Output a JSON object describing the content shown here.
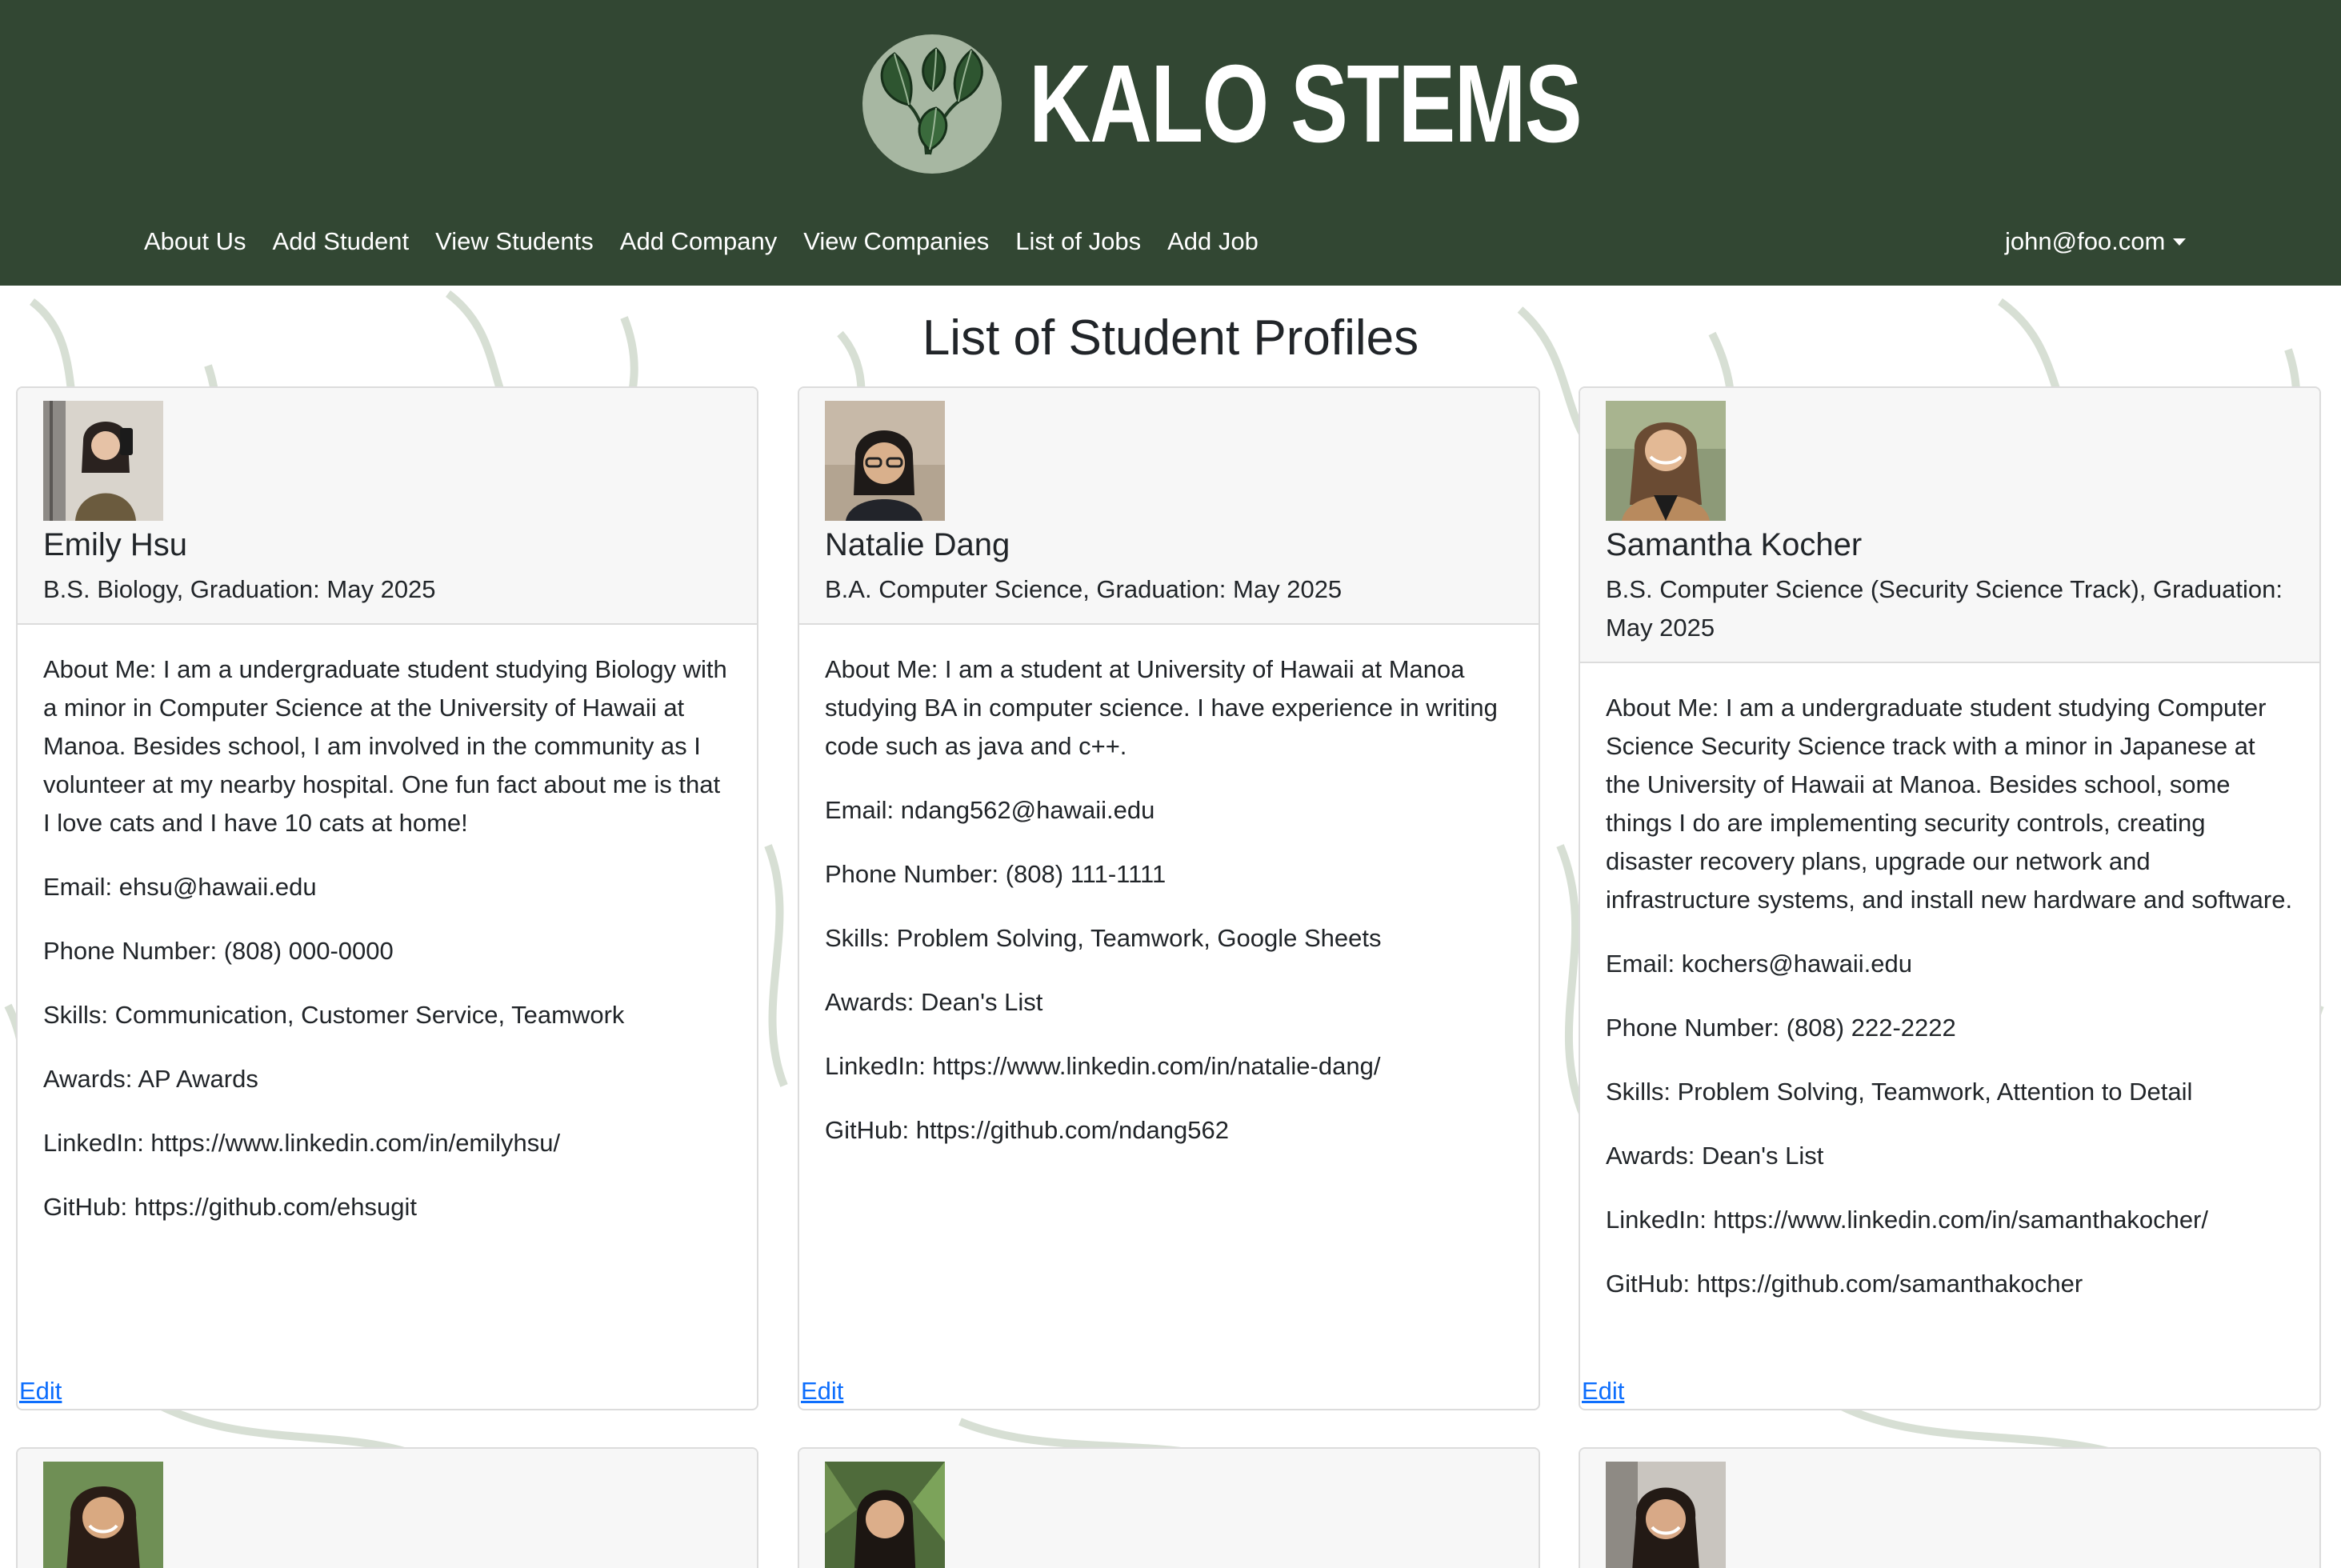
{
  "brand": {
    "title": "KALO STEMS",
    "logo_icon": "taro-leaf-icon",
    "color_navbar": "#324733"
  },
  "nav": {
    "items": [
      {
        "label": "About Us"
      },
      {
        "label": "Add Student"
      },
      {
        "label": "View Students"
      },
      {
        "label": "Add Company"
      },
      {
        "label": "View Companies"
      },
      {
        "label": "List of Jobs"
      },
      {
        "label": "Add Job"
      }
    ],
    "user": "john@foo.com"
  },
  "page": {
    "title": "List of Student Profiles"
  },
  "cards": [
    {
      "name": "Emily Hsu",
      "degree": "B.S. Biology, Graduation: May 2025",
      "about": "About Me: I am a undergraduate student studying Biology with a minor in Computer Science at the University of Hawaii at Manoa. Besides school, I am involved in the community as I volunteer at my nearby hospital. One fun fact about me is that I love cats and I have 10 cats at home!",
      "email": "Email: ehsu@hawaii.edu",
      "phone": "Phone Number: (808) 000-0000",
      "skills": "Skills: Communication, Customer Service, Teamwork",
      "awards": "Awards: AP Awards",
      "linkedin": "LinkedIn: https://www.linkedin.com/in/emilyhsu/",
      "github": "GitHub: https://github.com/ehsugit",
      "edit": "Edit"
    },
    {
      "name": "Natalie Dang",
      "degree": "B.A. Computer Science, Graduation: May 2025",
      "about": "About Me: I am a student at University of Hawaii at Manoa studying BA in computer science. I have experience in writing code such as java and c++.",
      "email": "Email: ndang562@hawaii.edu",
      "phone": "Phone Number: (808) 111-1111",
      "skills": "Skills: Problem Solving, Teamwork, Google Sheets",
      "awards": "Awards: Dean's List",
      "linkedin": "LinkedIn: https://www.linkedin.com/in/natalie-dang/",
      "github": "GitHub: https://github.com/ndang562",
      "edit": "Edit"
    },
    {
      "name": "Samantha Kocher",
      "degree": "B.S. Computer Science (Security Science Track), Graduation: May 2025",
      "about": "About Me: I am a undergraduate student studying Computer Science Security Science track with a minor in Japanese at the University of Hawaii at Manoa. Besides school, some things I do are implementing security controls, creating disaster recovery plans, upgrade our network and infrastructure systems, and install new hardware and software.",
      "email": "Email: kochers@hawaii.edu",
      "phone": "Phone Number: (808) 222-2222",
      "skills": "Skills: Problem Solving, Teamwork, Attention to Detail",
      "awards": "Awards: Dean's List",
      "linkedin": "LinkedIn: https://www.linkedin.com/in/samanthakocher/",
      "github": "GitHub: https://github.com/samanthakocher",
      "edit": "Edit"
    }
  ]
}
